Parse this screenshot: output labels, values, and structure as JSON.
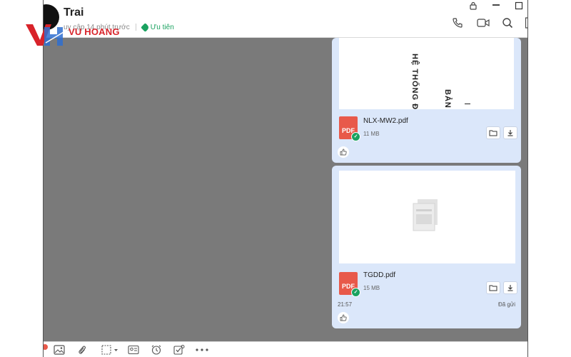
{
  "header": {
    "contact_name": "Trai",
    "status": "uy cập 14 phút trước",
    "priority_label": "Ưu tiên"
  },
  "watermark": {
    "brand": "VU HOANG"
  },
  "messages": [
    {
      "preview_text_1": "HỆ THỐNG Đ",
      "preview_text_2": "BẢN",
      "file_type": "PDF",
      "file_name": "NLX-MW2.pdf",
      "file_size": "11 MB"
    },
    {
      "file_type": "PDF",
      "file_name": "TGDD.pdf",
      "file_size": "15 MB",
      "time": "21:57",
      "sent_status": "Đã gửi"
    }
  ],
  "colors": {
    "bubble": "#dbe7fa",
    "pdf_red": "#e8594a",
    "status_green": "#1aa260",
    "chat_bg": "#7a7a7a",
    "brand_red": "#d8232a",
    "brand_blue": "#2f6fd0"
  },
  "icons": [
    "lock-icon",
    "minimize-icon",
    "maximize-icon",
    "phone-icon",
    "video-call-icon",
    "search-icon",
    "folder-icon",
    "download-icon",
    "like-icon",
    "image-icon",
    "attach-icon",
    "screenshot-icon",
    "contact-card-icon",
    "reminder-icon",
    "task-icon",
    "more-icon"
  ]
}
